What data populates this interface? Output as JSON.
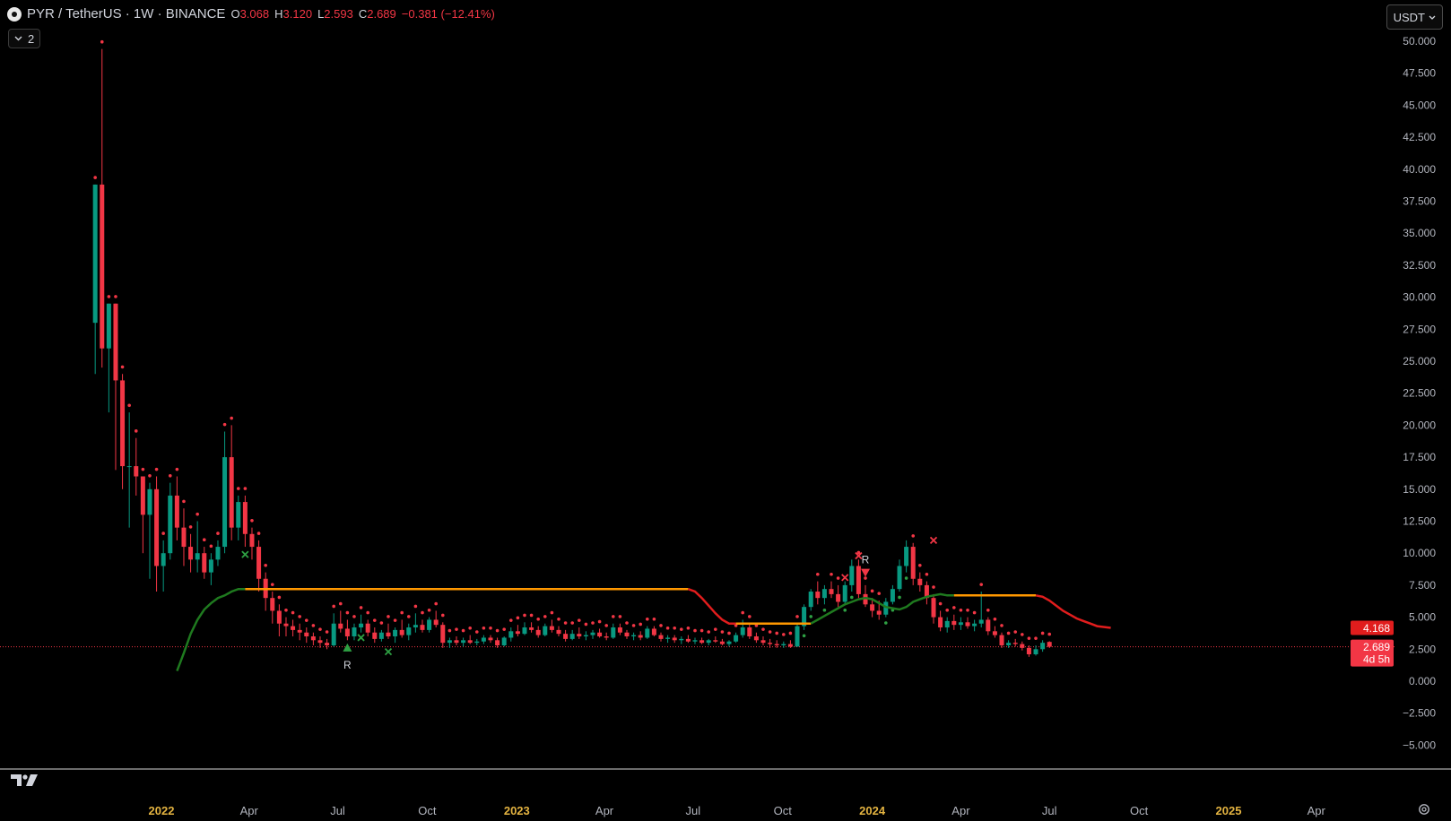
{
  "header": {
    "title": "PYR / TetherUS · 1W · BINANCE",
    "ohlc": [
      {
        "k": "O",
        "v": "3.068"
      },
      {
        "k": "H",
        "v": "3.120"
      },
      {
        "k": "L",
        "v": "2.593"
      },
      {
        "k": "C",
        "v": "2.689"
      }
    ],
    "change": "−0.381 (−12.41%)",
    "indicators_count": "2",
    "currency": "USDT"
  },
  "price_labels": {
    "line_value": "4.168",
    "last_price": "2.689",
    "countdown": "4d 5h"
  },
  "colors": {
    "up": "#089981",
    "down": "#f23645",
    "bull_line": "#1f7a1f",
    "flat_line": "#ff9800",
    "bear_line": "#e11d1d",
    "grid": "#000000",
    "background": "#000000"
  },
  "icons": [
    "tradingview-logo-icon",
    "chevron-down-icon",
    "settings-icon"
  ],
  "chart_data": {
    "type": "candlestick",
    "symbol": "PYR / TetherUS",
    "interval": "1W",
    "exchange": "BINANCE",
    "y_ticks": [
      "50.000",
      "47.500",
      "45.000",
      "42.500",
      "40.000",
      "37.500",
      "35.000",
      "32.500",
      "30.000",
      "27.500",
      "25.000",
      "22.500",
      "20.000",
      "17.500",
      "15.000",
      "12.500",
      "10.000",
      "7.500",
      "5.000",
      "2.500",
      "0.000",
      "−2.500",
      "−5.000"
    ],
    "ylim": [
      -5,
      50
    ],
    "x_ticks": [
      {
        "label": "2022",
        "date": "2022-01-01",
        "bold": true
      },
      {
        "label": "Apr",
        "date": "2022-04-01"
      },
      {
        "label": "Jul",
        "date": "2022-07-01"
      },
      {
        "label": "Oct",
        "date": "2022-10-01"
      },
      {
        "label": "2023",
        "date": "2023-01-01",
        "bold": true
      },
      {
        "label": "Apr",
        "date": "2023-04-01"
      },
      {
        "label": "Jul",
        "date": "2023-07-01"
      },
      {
        "label": "Oct",
        "date": "2023-10-01"
      },
      {
        "label": "2024",
        "date": "2024-01-01",
        "bold": true
      },
      {
        "label": "Apr",
        "date": "2024-04-01"
      },
      {
        "label": "Jul",
        "date": "2024-07-01"
      },
      {
        "label": "Oct",
        "date": "2024-10-01"
      },
      {
        "label": "2025",
        "date": "2025-01-01",
        "bold": true
      },
      {
        "label": "Apr",
        "date": "2025-04-01"
      }
    ],
    "xlim": [
      "2021-07-01",
      "2025-07-01"
    ],
    "first_bar": "2021-10-25",
    "bar_interval_days": 7,
    "candles": [
      [
        28.0,
        38.8,
        24.0,
        38.8
      ],
      [
        38.8,
        49.4,
        24.5,
        26.0
      ],
      [
        26.0,
        29.5,
        21.0,
        29.5
      ],
      [
        29.5,
        29.5,
        16.5,
        23.5
      ],
      [
        23.5,
        24.0,
        15.0,
        16.8
      ],
      [
        16.8,
        21.0,
        12.0,
        16.8
      ],
      [
        16.8,
        19.0,
        14.5,
        16.0
      ],
      [
        16.0,
        16.0,
        10.0,
        13.0
      ],
      [
        13.0,
        15.5,
        8.0,
        15.0
      ],
      [
        15.0,
        16.0,
        7.0,
        9.0
      ],
      [
        9.0,
        11.0,
        7.0,
        10.0
      ],
      [
        10.0,
        15.5,
        9.5,
        14.5
      ],
      [
        14.5,
        16.0,
        11.0,
        12.0
      ],
      [
        12.0,
        13.5,
        9.0,
        10.5
      ],
      [
        10.5,
        11.5,
        8.5,
        9.5
      ],
      [
        9.5,
        12.5,
        8.5,
        10.0
      ],
      [
        10.0,
        10.5,
        8.0,
        8.5
      ],
      [
        8.5,
        10.0,
        7.5,
        9.5
      ],
      [
        9.5,
        11.0,
        9.0,
        10.5
      ],
      [
        10.5,
        19.5,
        10.0,
        17.5
      ],
      [
        17.5,
        20.0,
        11.0,
        12.0
      ],
      [
        12.0,
        14.5,
        11.0,
        14.0
      ],
      [
        14.0,
        14.5,
        10.5,
        11.5
      ],
      [
        11.5,
        12.0,
        9.5,
        10.5
      ],
      [
        10.5,
        11.0,
        7.0,
        8.0
      ],
      [
        8.0,
        8.5,
        5.5,
        6.5
      ],
      [
        6.5,
        7.0,
        4.5,
        5.5
      ],
      [
        5.5,
        6.0,
        3.5,
        4.5
      ],
      [
        4.5,
        5.0,
        3.5,
        4.3
      ],
      [
        4.3,
        4.8,
        3.5,
        4.0
      ],
      [
        4.0,
        4.5,
        3.2,
        3.8
      ],
      [
        3.8,
        4.2,
        3.0,
        3.5
      ],
      [
        3.5,
        3.8,
        2.8,
        3.2
      ],
      [
        3.2,
        3.5,
        2.6,
        3.0
      ],
      [
        3.0,
        3.3,
        2.5,
        2.8
      ],
      [
        2.8,
        5.3,
        2.7,
        4.5
      ],
      [
        4.5,
        5.5,
        3.8,
        4.1
      ],
      [
        4.1,
        4.8,
        3.2,
        3.5
      ],
      [
        3.5,
        4.5,
        3.2,
        4.2
      ],
      [
        4.2,
        5.2,
        3.8,
        4.5
      ],
      [
        4.5,
        4.8,
        3.5,
        3.8
      ],
      [
        3.8,
        4.2,
        3.0,
        3.3
      ],
      [
        3.3,
        4.0,
        3.1,
        3.8
      ],
      [
        3.8,
        4.5,
        3.3,
        3.5
      ],
      [
        3.5,
        4.2,
        3.0,
        4.0
      ],
      [
        4.0,
        4.8,
        3.4,
        3.6
      ],
      [
        3.6,
        4.5,
        3.2,
        4.2
      ],
      [
        4.2,
        5.3,
        3.8,
        4.4
      ],
      [
        4.4,
        4.8,
        3.8,
        4.0
      ],
      [
        4.0,
        5.0,
        3.8,
        4.8
      ],
      [
        4.8,
        5.5,
        4.2,
        4.4
      ],
      [
        4.4,
        4.6,
        2.6,
        3.0
      ],
      [
        3.0,
        3.4,
        2.6,
        3.2
      ],
      [
        3.2,
        3.5,
        2.8,
        3.0
      ],
      [
        3.0,
        3.4,
        2.7,
        3.2
      ],
      [
        3.2,
        3.6,
        2.9,
        3.0
      ],
      [
        3.0,
        3.3,
        2.8,
        3.1
      ],
      [
        3.1,
        3.6,
        2.9,
        3.4
      ],
      [
        3.4,
        3.6,
        3.0,
        3.2
      ],
      [
        3.2,
        3.4,
        2.6,
        2.8
      ],
      [
        2.8,
        3.5,
        2.7,
        3.4
      ],
      [
        3.4,
        4.2,
        3.1,
        3.9
      ],
      [
        3.9,
        4.4,
        3.5,
        3.7
      ],
      [
        3.7,
        4.6,
        3.6,
        4.2
      ],
      [
        4.2,
        4.6,
        3.8,
        4.0
      ],
      [
        4.0,
        4.3,
        3.4,
        3.6
      ],
      [
        3.6,
        4.5,
        3.5,
        4.3
      ],
      [
        4.3,
        4.8,
        3.8,
        4.0
      ],
      [
        4.0,
        4.3,
        3.5,
        3.7
      ],
      [
        3.7,
        4.0,
        3.1,
        3.3
      ],
      [
        3.3,
        4.0,
        3.2,
        3.7
      ],
      [
        3.7,
        4.2,
        3.3,
        3.5
      ],
      [
        3.5,
        3.9,
        3.2,
        3.6
      ],
      [
        3.6,
        4.0,
        3.3,
        3.8
      ],
      [
        3.8,
        4.1,
        3.4,
        3.5
      ],
      [
        3.5,
        3.8,
        3.2,
        3.4
      ],
      [
        3.4,
        4.5,
        3.3,
        4.2
      ],
      [
        4.2,
        4.5,
        3.6,
        3.8
      ],
      [
        3.8,
        4.0,
        3.3,
        3.5
      ],
      [
        3.5,
        3.8,
        3.2,
        3.6
      ],
      [
        3.6,
        3.9,
        3.2,
        3.4
      ],
      [
        3.4,
        4.3,
        3.3,
        4.1
      ],
      [
        4.1,
        4.3,
        3.5,
        3.6
      ],
      [
        3.6,
        3.8,
        3.1,
        3.3
      ],
      [
        3.3,
        3.6,
        3.0,
        3.4
      ],
      [
        3.4,
        3.6,
        3.0,
        3.2
      ],
      [
        3.2,
        3.5,
        2.9,
        3.3
      ],
      [
        3.3,
        3.6,
        3.0,
        3.1
      ],
      [
        3.1,
        3.4,
        2.9,
        3.2
      ],
      [
        3.2,
        3.4,
        2.9,
        3.0
      ],
      [
        3.0,
        3.3,
        2.8,
        3.2
      ],
      [
        3.2,
        3.5,
        3.0,
        3.1
      ],
      [
        3.1,
        3.3,
        2.8,
        2.9
      ],
      [
        2.9,
        3.2,
        2.7,
        3.1
      ],
      [
        3.1,
        3.8,
        3.0,
        3.6
      ],
      [
        3.6,
        4.8,
        3.4,
        4.2
      ],
      [
        4.2,
        4.5,
        3.3,
        3.5
      ],
      [
        3.5,
        3.8,
        3.0,
        3.2
      ],
      [
        3.2,
        3.5,
        2.8,
        3.0
      ],
      [
        3.0,
        3.3,
        2.6,
        2.9
      ],
      [
        2.9,
        3.2,
        2.6,
        2.8
      ],
      [
        2.8,
        3.1,
        2.6,
        2.9
      ],
      [
        2.9,
        3.2,
        2.6,
        2.7
      ],
      [
        2.7,
        4.5,
        2.7,
        4.3
      ],
      [
        4.3,
        6.0,
        4.0,
        5.8
      ],
      [
        5.8,
        7.2,
        5.5,
        7.0
      ],
      [
        7.0,
        7.8,
        6.0,
        6.5
      ],
      [
        6.5,
        7.5,
        6.0,
        7.2
      ],
      [
        7.2,
        7.8,
        6.5,
        6.8
      ],
      [
        6.8,
        7.5,
        5.8,
        6.2
      ],
      [
        6.2,
        7.8,
        6.0,
        7.5
      ],
      [
        7.5,
        9.5,
        7.0,
        9.0
      ],
      [
        9.0,
        9.5,
        6.5,
        6.8
      ],
      [
        6.8,
        7.5,
        5.8,
        6.0
      ],
      [
        6.0,
        6.5,
        5.0,
        5.5
      ],
      [
        5.5,
        6.3,
        4.8,
        5.2
      ],
      [
        5.2,
        6.5,
        5.0,
        6.2
      ],
      [
        6.2,
        7.5,
        6.0,
        7.2
      ],
      [
        7.2,
        9.5,
        7.0,
        9.0
      ],
      [
        9.0,
        11.0,
        8.5,
        10.5
      ],
      [
        10.5,
        10.8,
        7.5,
        8.0
      ],
      [
        8.0,
        8.5,
        7.0,
        7.5
      ],
      [
        7.5,
        7.8,
        6.0,
        6.5
      ],
      [
        6.5,
        6.8,
        4.5,
        5.0
      ],
      [
        5.0,
        5.5,
        3.9,
        4.2
      ],
      [
        4.2,
        5.0,
        3.8,
        4.7
      ],
      [
        4.7,
        5.2,
        4.0,
        4.4
      ],
      [
        4.4,
        5.0,
        4.0,
        4.6
      ],
      [
        4.6,
        5.0,
        4.1,
        4.3
      ],
      [
        4.3,
        4.8,
        3.9,
        4.5
      ],
      [
        4.5,
        7.0,
        4.2,
        4.8
      ],
      [
        4.8,
        5.0,
        3.6,
        3.9
      ],
      [
        3.9,
        4.3,
        3.4,
        3.6
      ],
      [
        3.6,
        3.8,
        2.6,
        2.8
      ],
      [
        2.8,
        3.2,
        2.6,
        3.0
      ],
      [
        3.0,
        3.3,
        2.7,
        2.9
      ],
      [
        2.9,
        3.1,
        2.4,
        2.6
      ],
      [
        2.6,
        2.8,
        1.9,
        2.1
      ],
      [
        2.1,
        2.8,
        2.0,
        2.5
      ],
      [
        2.5,
        3.2,
        2.3,
        3.0
      ],
      [
        3.068,
        3.12,
        2.593,
        2.689
      ]
    ],
    "trend_line": {
      "points": [
        [
          "2022-01-17",
          0.8
        ],
        [
          "2022-01-24",
          2.2
        ],
        [
          "2022-01-31",
          3.7
        ],
        [
          "2022-02-07",
          4.8
        ],
        [
          "2022-02-14",
          5.6
        ],
        [
          "2022-02-21",
          6.1
        ],
        [
          "2022-02-28",
          6.5
        ],
        [
          "2022-03-07",
          6.7
        ],
        [
          "2022-03-14",
          7.0
        ],
        [
          "2022-03-21",
          7.2
        ],
        [
          "2022-03-28",
          7.2
        ],
        [
          "2023-06-19",
          7.2
        ],
        [
          "2023-06-26",
          7.2
        ],
        [
          "2023-07-03",
          7.0
        ],
        [
          "2023-07-10",
          6.5
        ],
        [
          "2023-07-17",
          5.9
        ],
        [
          "2023-07-24",
          5.3
        ],
        [
          "2023-07-31",
          4.8
        ],
        [
          "2023-08-07",
          4.5
        ],
        [
          "2023-08-14",
          4.5
        ],
        [
          "2023-10-30",
          4.5
        ],
        [
          "2023-11-06",
          4.8
        ],
        [
          "2023-11-13",
          5.1
        ],
        [
          "2023-11-20",
          5.4
        ],
        [
          "2023-11-27",
          5.7
        ],
        [
          "2023-12-04",
          6.0
        ],
        [
          "2023-12-11",
          6.2
        ],
        [
          "2023-12-18",
          6.4
        ],
        [
          "2023-12-25",
          6.5
        ],
        [
          "2024-01-01",
          6.4
        ],
        [
          "2024-01-08",
          6.1
        ],
        [
          "2024-01-15",
          5.8
        ],
        [
          "2024-01-22",
          5.7
        ],
        [
          "2024-01-29",
          5.6
        ],
        [
          "2024-02-05",
          5.8
        ],
        [
          "2024-02-12",
          6.2
        ],
        [
          "2024-02-19",
          6.4
        ],
        [
          "2024-02-26",
          6.6
        ],
        [
          "2024-03-04",
          6.7
        ],
        [
          "2024-03-11",
          6.8
        ],
        [
          "2024-03-18",
          6.7
        ],
        [
          "2024-03-25",
          6.7
        ],
        [
          "2024-06-17",
          6.7
        ],
        [
          "2024-06-24",
          6.6
        ],
        [
          "2024-07-01",
          6.3
        ],
        [
          "2024-07-08",
          5.9
        ],
        [
          "2024-07-15",
          5.5
        ],
        [
          "2024-07-22",
          5.2
        ],
        [
          "2024-07-29",
          4.9
        ],
        [
          "2024-08-05",
          4.7
        ],
        [
          "2024-08-12",
          4.5
        ],
        [
          "2024-08-19",
          4.3
        ],
        [
          "2024-09-02",
          4.168
        ]
      ],
      "segments": [
        {
          "from": "2022-01-17",
          "to": "2022-03-28",
          "trend": "bull"
        },
        {
          "from": "2022-03-28",
          "to": "2023-06-26",
          "trend": "flat"
        },
        {
          "from": "2023-06-26",
          "to": "2023-08-14",
          "trend": "bear"
        },
        {
          "from": "2023-08-14",
          "to": "2023-10-30",
          "trend": "flat"
        },
        {
          "from": "2023-10-30",
          "to": "2024-03-25",
          "trend": "bull"
        },
        {
          "from": "2024-03-25",
          "to": "2024-06-17",
          "trend": "flat"
        },
        {
          "from": "2024-06-17",
          "to": "2024-09-02",
          "trend": "bear"
        }
      ]
    },
    "markers": [
      {
        "date": "2022-03-28",
        "price": 9.9,
        "type": "cross",
        "color": "green"
      },
      {
        "date": "2022-07-11",
        "price": 2.6,
        "type": "triangle-up",
        "color": "green",
        "label": "R"
      },
      {
        "date": "2022-07-25",
        "price": 3.4,
        "type": "cross",
        "color": "green"
      },
      {
        "date": "2022-08-22",
        "price": 2.3,
        "type": "cross",
        "color": "green"
      },
      {
        "date": "2023-12-04",
        "price": 8.1,
        "type": "cross",
        "color": "red"
      },
      {
        "date": "2023-12-18",
        "price": 9.8,
        "type": "cross",
        "color": "red"
      },
      {
        "date": "2023-12-25",
        "price": 8.5,
        "type": "triangle-down",
        "color": "red",
        "label": "R"
      },
      {
        "date": "2024-03-04",
        "price": 11.0,
        "type": "cross",
        "color": "red"
      }
    ],
    "last_price": 2.689,
    "line_value": 4.168
  }
}
